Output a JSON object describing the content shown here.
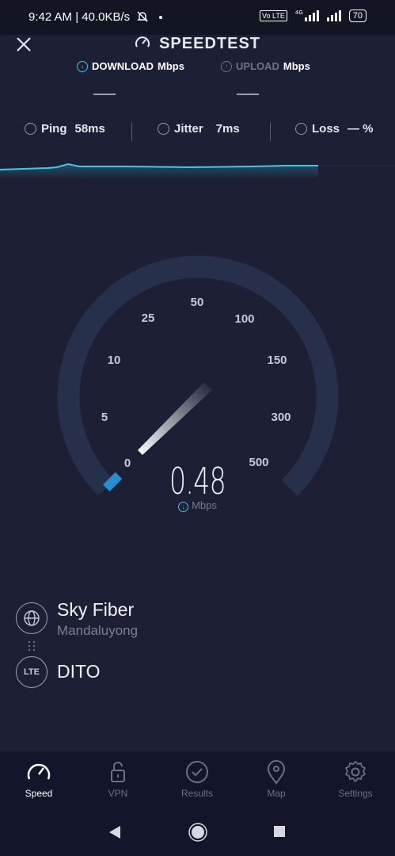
{
  "status_bar": {
    "time_net": "9:42 AM | 40.0KB/s",
    "volte": "Vo LTE",
    "net_type": "4G",
    "battery": "70"
  },
  "header": {
    "title": "SPEEDTEST",
    "tab_download": "DOWNLOAD",
    "tab_upload": "UPLOAD",
    "unit": "Mbps",
    "download_value": "—",
    "upload_value": "—"
  },
  "stats": {
    "ping_label": "Ping",
    "ping_value": "58ms",
    "jitter_label": "Jitter",
    "jitter_value": "7ms",
    "loss_label": "Loss",
    "loss_value": "— %"
  },
  "gauge": {
    "ticks": [
      "0",
      "5",
      "10",
      "25",
      "50",
      "100",
      "150",
      "300",
      "500"
    ],
    "current_speed": "0.48",
    "unit": "Mbps",
    "needle_value": 0.48
  },
  "connection": {
    "isp_name": "Sky Fiber",
    "isp_location": "Mandaluyong",
    "carrier_badge": "LTE",
    "carrier_name": "DITO"
  },
  "bottom_nav": [
    {
      "label": "Speed",
      "icon": "speedometer-icon",
      "active": true
    },
    {
      "label": "VPN",
      "icon": "lock-icon",
      "active": false
    },
    {
      "label": "Results",
      "icon": "check-circle-icon",
      "active": false
    },
    {
      "label": "Map",
      "icon": "map-pin-icon",
      "active": false
    },
    {
      "label": "Settings",
      "icon": "gear-icon",
      "active": false
    }
  ],
  "colors": {
    "accent": "#34c3e8",
    "background": "#1d2034",
    "gauge_track": "#27304a"
  }
}
